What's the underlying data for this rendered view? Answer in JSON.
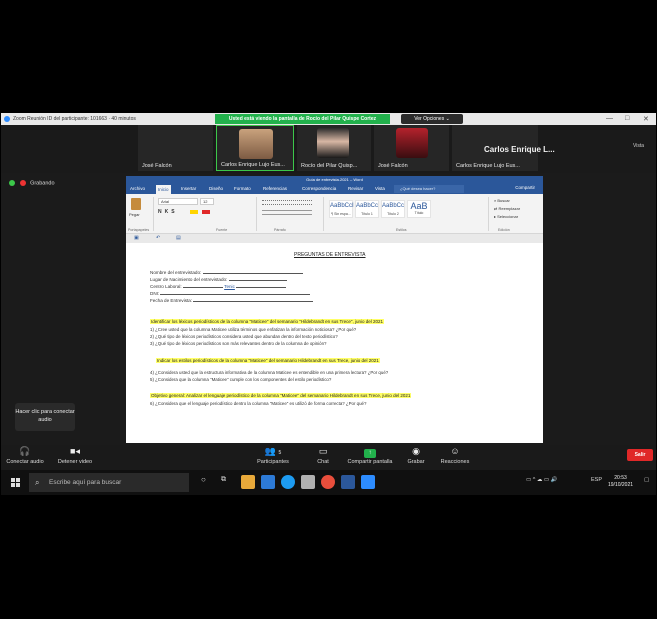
{
  "zoom": {
    "window_title": "Zoom Reunión ID del participante: 101663 · 40 minutos",
    "share_banner": "Usted está viendo la pantalla de Rocío del Pilar Quispe Cortez",
    "view_options": "Ver Opciones ⌄",
    "window_controls": [
      "—",
      "□",
      "✕"
    ],
    "side_view_label": "Vista",
    "participants": [
      {
        "name": "José Falcón"
      },
      {
        "name": "Carlos Enrique Lujo Eus..."
      },
      {
        "name": "Rocío del Pilar Quisp..."
      },
      {
        "name": "José Falcón"
      },
      {
        "name": "Carlos Enrique Lujo Eus..."
      }
    ],
    "active_speaker": "Carlos Enrique L...",
    "recording_label": "Grabando",
    "audio_tip": "Hacer clic para conectar audio",
    "toolbar": {
      "connect_audio": "Conectar audio",
      "start_video": "Detener video",
      "participants": "Participantes",
      "participants_count": "5",
      "chat": "Chat",
      "share_screen": "Compartir pantalla",
      "record": "Grabar",
      "reactions": "Reacciones",
      "leave": "Salir"
    }
  },
  "word": {
    "title": "Guía de entrevista.2021 – Word",
    "tabs": [
      "Archivo",
      "Inicio",
      "Insertar",
      "Diseño",
      "Formato",
      "Referencias",
      "Correspondencia",
      "Revisar",
      "Vista"
    ],
    "active_tab": "Inicio",
    "tell_me": "¿Qué desea hacer?",
    "share": "Compartir",
    "ribbon": {
      "paste": "Pegar",
      "clipboard": "Portapapeles",
      "font_name": "Arial",
      "font_size": "12",
      "font_group": "Fuente",
      "paragraph_group": "Párrafo",
      "styles_group": "Estilos",
      "editing_group": "Edición",
      "find": "Buscar",
      "replace": "Reemplazar",
      "select": "Seleccionar",
      "styles": [
        {
          "sample": "AaBbCcI",
          "name": "¶ Sin espa..."
        },
        {
          "sample": "AaBbCc",
          "name": "Título 1"
        },
        {
          "sample": "AaBbCc",
          "name": "Título 2"
        },
        {
          "sample": "AaB",
          "name": "Título"
        }
      ]
    },
    "document": {
      "heading": "PREGUNTAS DE ENTREVISTA",
      "fields": [
        "Nombre del entrevistado:",
        "Lugar de Nacimiento del entrevistado:",
        "Centro Laboral:",
        "DNI:",
        "Fecha de Entrevista:"
      ],
      "centro_value": "Tenic",
      "objectives": [
        "Identificar los léxicos periodísticos de la columna \"Maticee\" del semanario \"Hildebrandt en sus Trece\", junio del 2021",
        "Indicar los estilos periodísticos de la columna \"Maticee\" del semanario Hildebrandt en sus Trece, junio del 2021",
        "Objetivo general: Analizar el lenguaje periodístico de la columna \"Maticee\" del semanario Hildebrandt en sus Trece, junio del 2021"
      ],
      "questions_group1": [
        "1)  ¿Cree usted que la columna Maticee utiliza términos que enfatizan la información noticiosa? ¿Por qué?",
        "2)  ¿Qué tipo de léxicos periodísticos considera usted que abundan    dentro del texto periodístico?",
        "3)  ¿Qué tipo de léxicos periodísticos son más relevantes dentro de la columna de opinión?"
      ],
      "questions_group2": [
        "4)  ¿Considera usted que la estructura informativa de la columna Maticee es entendible en una primera lectura? ¿Por qué?",
        "5)  ¿Considera que la columna \"Maticee\" cumple con los componentes del estilo periodístico?"
      ],
      "questions_group3": [
        "6)  ¿Considera que el lenguaje periodístico dentro la columna \"Maticee\" es utilizó de forma correcta? ¿Por qué?"
      ]
    }
  },
  "taskbar": {
    "search_placeholder": "Escribe aquí para buscar",
    "language": "ESP",
    "time": "20:53",
    "date": "19/10/2021"
  }
}
